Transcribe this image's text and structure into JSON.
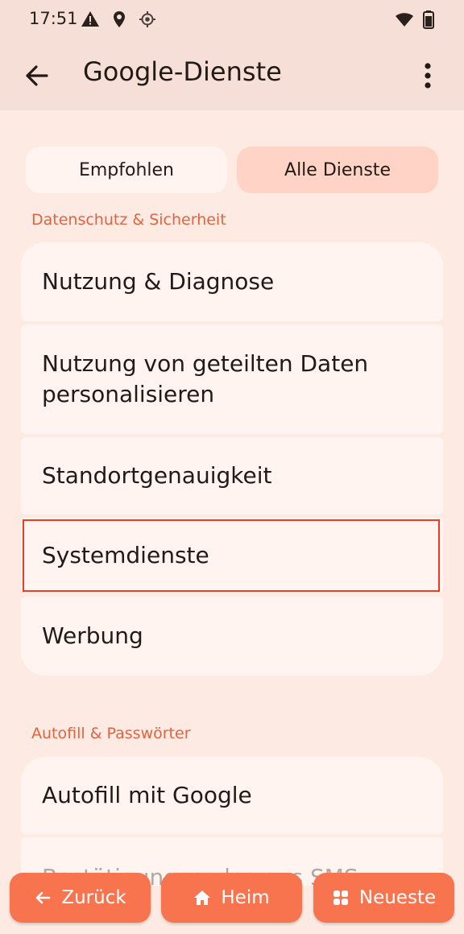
{
  "status": {
    "time": "17:51",
    "icons": [
      "warning-icon",
      "location-pin-icon",
      "gps-icon",
      "wifi-icon",
      "battery-icon"
    ]
  },
  "appbar": {
    "title": "Google-Dienste",
    "back_icon": "back-arrow-icon",
    "more_icon": "more-vert-icon"
  },
  "tabs": [
    {
      "label": "Empfohlen",
      "selected": false
    },
    {
      "label": "Alle Dienste",
      "selected": true
    }
  ],
  "sections": [
    {
      "title": "Datenschutz & Sicherheit",
      "items": [
        {
          "label": "Nutzung & Diagnose"
        },
        {
          "label": "Nutzung von geteilten Daten personalisieren"
        },
        {
          "label": "Standortgenauigkeit"
        },
        {
          "label": "Systemdienste",
          "highlighted": true
        },
        {
          "label": "Werbung"
        }
      ]
    },
    {
      "title": "Autofill & Passwörter",
      "items": [
        {
          "label": "Autofill mit Google"
        },
        {
          "label": "Bestätigungscodes aus SMS"
        }
      ]
    }
  ],
  "nav": {
    "back": {
      "label": "Zurück",
      "icon": "arrow-left-icon"
    },
    "home": {
      "label": "Heim",
      "icon": "home-icon"
    },
    "recent": {
      "label": "Neueste",
      "icon": "grid-icon"
    }
  },
  "colors": {
    "background": "#fdeae3",
    "appbar": "#f6dfd7",
    "accent": "#e4633f",
    "selected_tab": "#ffd4c6",
    "nav_button": "#f7744f",
    "highlight_border": "#ee3b24"
  }
}
